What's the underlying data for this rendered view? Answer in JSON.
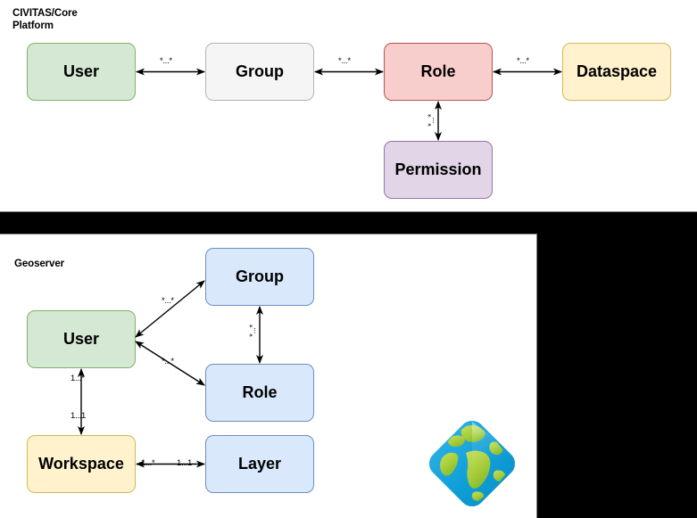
{
  "panels": {
    "core": {
      "title": "CIVITAS/Core\nPlatform",
      "name": "civitas-core-platform"
    },
    "geoserver": {
      "title": "Geoserver",
      "name": "geoserver"
    }
  },
  "core_nodes": [
    {
      "id": "user",
      "label": "User"
    },
    {
      "id": "group",
      "label": "Group"
    },
    {
      "id": "role",
      "label": "Role"
    },
    {
      "id": "dataspace",
      "label": "Dataspace"
    },
    {
      "id": "permission",
      "label": "Permission"
    }
  ],
  "core_edges": [
    {
      "id": "user-group",
      "from": "User",
      "to": "Group",
      "label": "*...*"
    },
    {
      "id": "group-role",
      "from": "Group",
      "to": "Role",
      "label": "*...*"
    },
    {
      "id": "role-dataspace",
      "from": "Role",
      "to": "Dataspace",
      "label": "*...*"
    },
    {
      "id": "role-permission",
      "from": "Role",
      "to": "Permission",
      "label": "*...*"
    }
  ],
  "geo_nodes": [
    {
      "id": "geo-group",
      "label": "Group"
    },
    {
      "id": "geo-user",
      "label": "User"
    },
    {
      "id": "geo-role",
      "label": "Role"
    },
    {
      "id": "geo-workspace",
      "label": "Workspace"
    },
    {
      "id": "geo-layer",
      "label": "Layer"
    }
  ],
  "geo_edges": [
    {
      "id": "user-group",
      "from": "User",
      "to": "Group",
      "label": "*...*"
    },
    {
      "id": "user-role",
      "from": "User",
      "to": "Role",
      "label": "*...*"
    },
    {
      "id": "group-role",
      "from": "Group",
      "to": "Role",
      "label": "*...*"
    },
    {
      "id": "workspace-user",
      "from": "Workspace",
      "to": "User",
      "label_near_user": "1...*",
      "label_near_workspace": "1...1"
    },
    {
      "id": "workspace-layer",
      "from": "Workspace",
      "to": "Layer",
      "label_near_workspace": "1...*",
      "label_near_layer": "1...1"
    }
  ],
  "logo": {
    "name": "geoserver-globe-logo",
    "alt": "GeoServer globe logo"
  },
  "colors": {
    "green_fill": "#d5e8d4",
    "green_stroke": "#82b366",
    "grey_fill": "#f5f5f5",
    "grey_stroke": "#b3b3b3",
    "red_fill": "#f8cecc",
    "red_stroke": "#b85450",
    "yellow_fill": "#fff2cc",
    "yellow_stroke": "#d6b656",
    "purple_fill": "#e1d5e7",
    "purple_stroke": "#9673a6",
    "blue_fill": "#dae8fc",
    "blue_stroke": "#6c8ebf",
    "background": "#000000",
    "panel": "#ffffff",
    "logo_globe_blue": "#1b9bd7",
    "logo_globe_green": "#a6ce39"
  }
}
